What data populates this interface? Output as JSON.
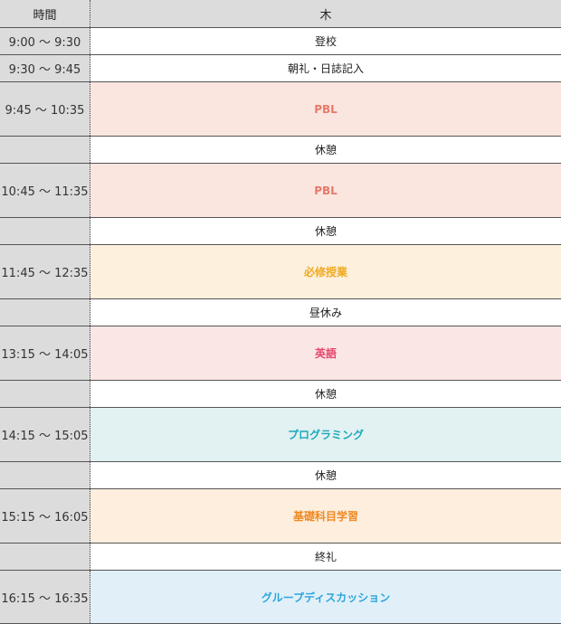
{
  "header": {
    "time_label": "時間",
    "day_label": "木"
  },
  "rows": [
    {
      "time": "9:00 〜 9:30",
      "activity": "登校",
      "bg": "#ffffff",
      "color": "#222222",
      "bold": false
    },
    {
      "time": "9:30 〜 9:45",
      "activity": "朝礼・日誌記入",
      "bg": "#ffffff",
      "color": "#222222",
      "bold": false
    },
    {
      "time": "9:45 〜 10:35",
      "activity": "PBL",
      "bg": "#fbe6df",
      "color": "#e8796a",
      "bold": true
    },
    {
      "time": "",
      "activity": "休憩",
      "bg": "#ffffff",
      "color": "#222222",
      "bold": false
    },
    {
      "time": "10:45 〜 11:35",
      "activity": "PBL",
      "bg": "#fbe6df",
      "color": "#e8796a",
      "bold": true
    },
    {
      "time": "",
      "activity": "休憩",
      "bg": "#ffffff",
      "color": "#222222",
      "bold": false
    },
    {
      "time": "11:45 〜 12:35",
      "activity": "必修授業",
      "bg": "#fdf0dc",
      "color": "#f0a91e",
      "bold": true
    },
    {
      "time": "",
      "activity": "昼休み",
      "bg": "#ffffff",
      "color": "#222222",
      "bold": false
    },
    {
      "time": "13:15 〜 14:05",
      "activity": "英語",
      "bg": "#fbe6e6",
      "color": "#e5476b",
      "bold": true
    },
    {
      "time": "",
      "activity": "休憩",
      "bg": "#ffffff",
      "color": "#222222",
      "bold": false
    },
    {
      "time": "14:15 〜 15:05",
      "activity": "プログラミング",
      "bg": "#e2f1f2",
      "color": "#1aaabb",
      "bold": true
    },
    {
      "time": "",
      "activity": "休憩",
      "bg": "#ffffff",
      "color": "#222222",
      "bold": false
    },
    {
      "time": "15:15 〜 16:05",
      "activity": "基礎科目学習",
      "bg": "#fdeedd",
      "color": "#ef8a24",
      "bold": true
    },
    {
      "time": "",
      "activity": "終礼",
      "bg": "#ffffff",
      "color": "#222222",
      "bold": false
    },
    {
      "time": "16:15 〜 16:35",
      "activity": "グループディスカッション",
      "bg": "#e1f0f8",
      "color": "#2ca5dc",
      "bold": true
    }
  ]
}
